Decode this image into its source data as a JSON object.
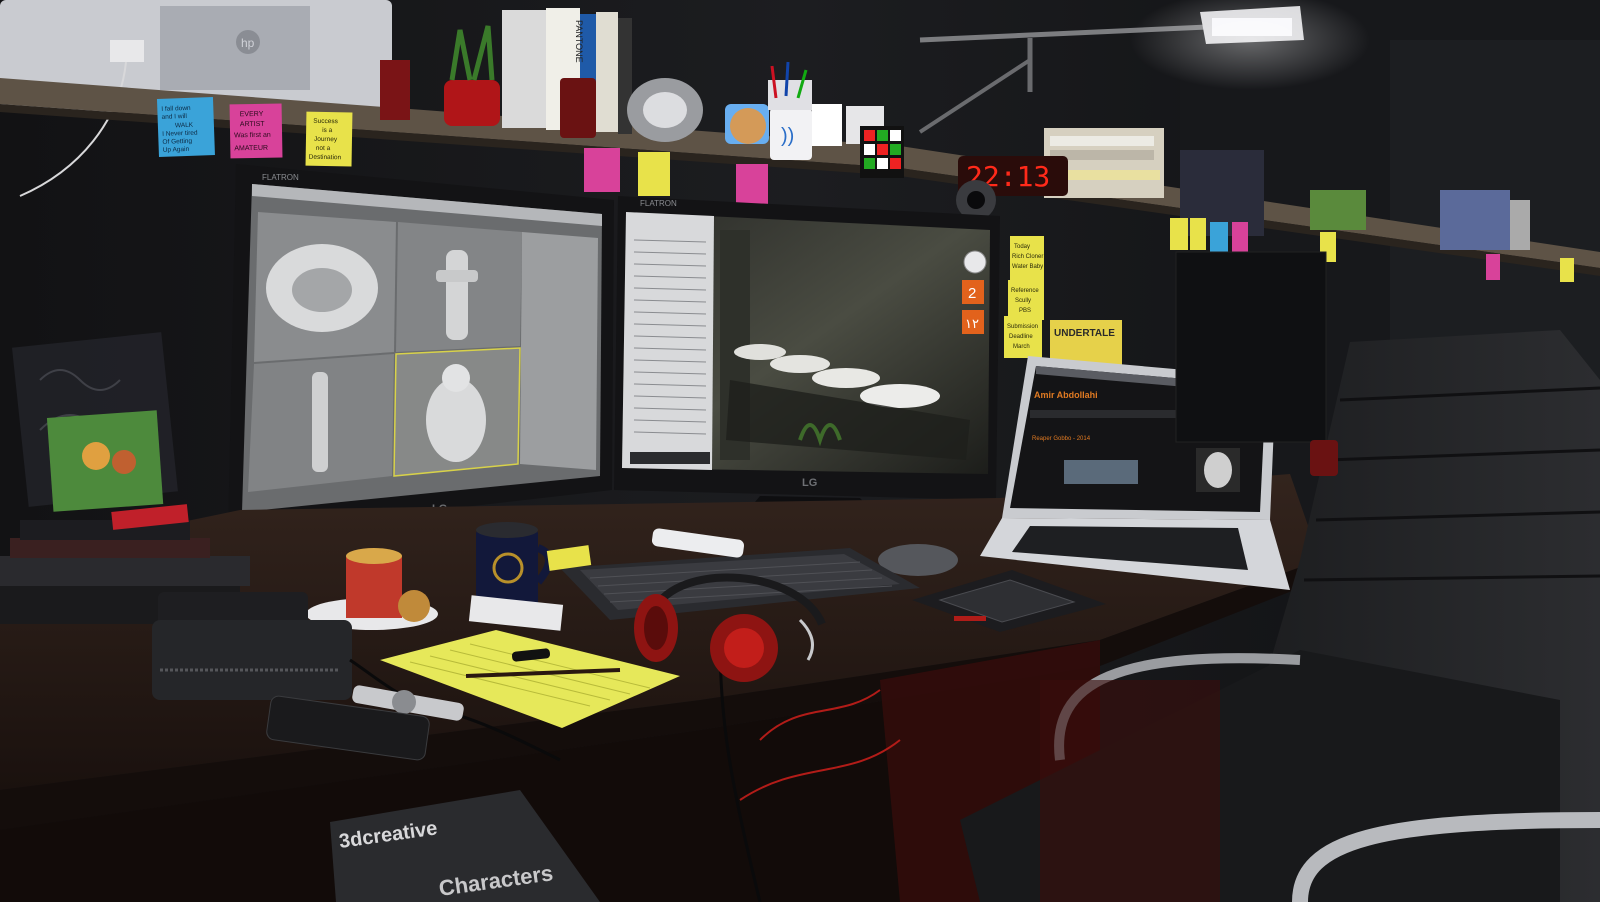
{
  "colors": {
    "room_dark": "#0b0b0c",
    "wall": "#1a1b1e",
    "shelf": "#6a5d4e",
    "desk_top": "#2a1d18",
    "desk_front": "#1c1411",
    "monitor_bezel": "#131315",
    "viewport_gray": "#8a8c8e",
    "sticky_yellow": "#e8e24a",
    "sticky_pink": "#d8429a",
    "sticky_blue": "#3aa3d9",
    "clock_red": "#ff2a1a",
    "notepad_yellow": "#e6e85a",
    "headphone_red": "#8e1412",
    "laptop_accent": "#e07a22",
    "orange_tile": "#e2621c"
  },
  "shelf_notes": {
    "note1": [
      "I fall down",
      "and I will",
      "WALK",
      "I Never tired",
      "Of Getting",
      "Up Again"
    ],
    "note2": [
      "EVERY",
      "ARTIST",
      "Was first an",
      "AMATEUR"
    ],
    "note3": [
      "Success",
      "is a",
      "Journey",
      "not a",
      "Destination"
    ]
  },
  "printer_brand": "hp",
  "book_spine": "PANTONE",
  "digital_clock": "22:13",
  "monitor_brand_label": "FLATRON",
  "monitor_logo": "LG",
  "right_screen_tiles": [
    "2",
    "١٢"
  ],
  "wall_notes": [
    "Today",
    "Rich Cloner",
    "Water Baby",
    "Reference",
    "Scully",
    "PBS",
    "Submission",
    "Deadline",
    "March"
  ],
  "poster_text": "UNDERTALE",
  "laptop": {
    "site_title": "Amir Abdollahi",
    "post_title": "Reaper Gobbo - 2014"
  },
  "magazine_title": "3dcreative",
  "magazine_subtitle": "Characters"
}
